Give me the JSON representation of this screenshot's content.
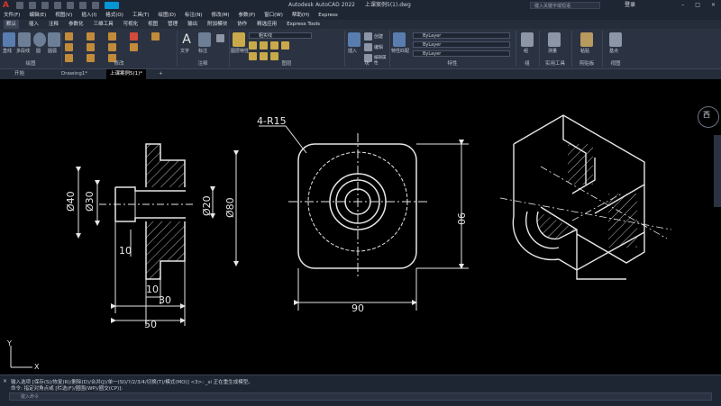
{
  "titlebar": {
    "app_title": "Autodesk AutoCAD 2022",
    "file_name": "上课案例5(1).dwg",
    "search_placeholder": "键入关键字或短语",
    "user": "登录",
    "share": "共享"
  },
  "menubar": [
    "文件(F)",
    "编辑(E)",
    "视图(V)",
    "插入(I)",
    "格式(O)",
    "工具(T)",
    "绘图(D)",
    "标注(N)",
    "修改(M)",
    "参数(P)",
    "窗口(W)",
    "帮助(H)",
    "Express"
  ],
  "ribbon_tabs": {
    "items": [
      "默认",
      "插入",
      "注释",
      "参数化",
      "三维工具",
      "可视化",
      "视图",
      "管理",
      "输出",
      "附加模块",
      "协作",
      "精选应用",
      "Express Tools"
    ],
    "active": "默认"
  },
  "ribbon": {
    "draw_label": "绘图",
    "modify_label": "修改",
    "annotation_label": "注释",
    "layers_label": "图层",
    "block_label": "块",
    "properties_label": "特性",
    "groups_label": "组",
    "utilities_label": "实用工具",
    "clipboard_label": "剪贴板",
    "view_label": "视图",
    "line": "直线",
    "polyline": "多段线",
    "circle": "圆",
    "arc": "圆弧",
    "text": "文字",
    "dimension": "标注",
    "layer_props": "图层特性",
    "layer_current": "粗实线",
    "insert": "插入",
    "create": "创建",
    "edit": "编辑",
    "edit_attr": "编辑属性",
    "match_props": "特性匹配",
    "bylayer1": "ByLayer",
    "bylayer2": "ByLayer",
    "bylayer3": "ByLayer",
    "group": "组",
    "measure": "测量",
    "paste": "粘贴",
    "base": "基点"
  },
  "doc_tabs": [
    "开始",
    "Drawing1*",
    "上课案例5(1)*"
  ],
  "drawing": {
    "dims_left": {
      "d40": "Ø40",
      "d30": "Ø30",
      "d20": "Ø20",
      "d80": "Ø80",
      "l10a": "10",
      "l10b": "10",
      "l30": "30",
      "l50": "50"
    },
    "dims_mid": {
      "r15": "4-R15",
      "w90": "90",
      "h90": "90"
    },
    "ucs_x": "X",
    "ucs_y": "Y"
  },
  "command": {
    "line1": "输入选项 [保存(S)/恢复(R)/删除(D)/合并(J)/单一(SI)/?/2/3/4/切换(T)/模式(MO)] <3>: _si 正在重生成模型。",
    "line2": "命令: 指定对角点或 [栏选(F)/圈围(WP)/圈交(CP)]:",
    "input_placeholder": "键入命令"
  },
  "viewcube": {
    "face": "西"
  },
  "colors": {
    "bg": "#000000",
    "ribbon": "#2b3342",
    "accent": "#0696d7"
  }
}
